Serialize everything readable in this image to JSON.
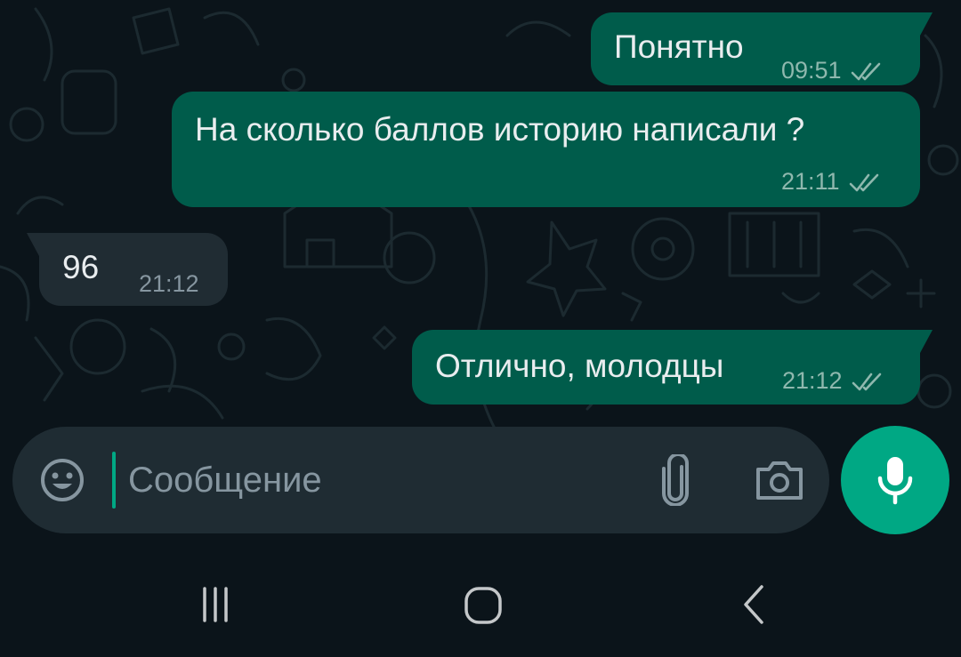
{
  "messages": [
    {
      "direction": "outgoing",
      "text": "Понятно",
      "time": "09:51",
      "status": "read-icon"
    },
    {
      "direction": "outgoing",
      "text": "На сколько баллов историю написали ?",
      "time": "21:11",
      "status": "read-icon"
    },
    {
      "direction": "incoming",
      "text": "96",
      "time": "21:12"
    },
    {
      "direction": "outgoing",
      "text": "Отлично, молодцы",
      "time": "21:12",
      "status": "read-icon"
    }
  ],
  "composer": {
    "placeholder": "Сообщение",
    "value": "",
    "icons": [
      "emoji-icon",
      "attach-icon",
      "camera-icon",
      "microphone-icon"
    ]
  },
  "navbar": {
    "icons": [
      "recent-apps-icon",
      "home-icon",
      "back-icon"
    ]
  },
  "colors": {
    "background": "#0b141a",
    "outgoing_bubble": "#005c4b",
    "incoming_bubble": "#202c33",
    "accent": "#00a884",
    "composer": "#1f2c33",
    "read_ticks": "#8fb8ae"
  }
}
